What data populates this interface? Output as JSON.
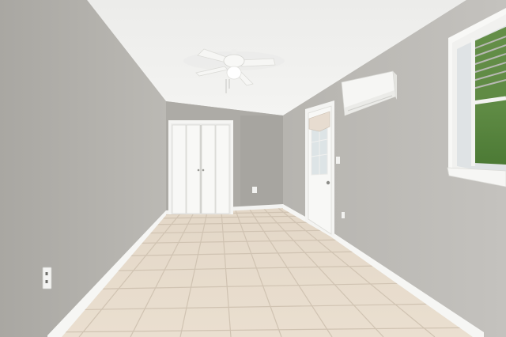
{
  "scene": {
    "subject": "empty-room-interior",
    "palette": {
      "ceiling": "#f1f1ef",
      "left_wall": "#b9b7b2",
      "back_wall": "#aeaca7",
      "right_wall": "#bebcb8",
      "floor_tile": "#e6d9c8",
      "grout": "#cfc2b1",
      "trim": "#f7f7f5",
      "foliage": "#5f8a43"
    },
    "fixtures": [
      "ceiling-fan",
      "closet-bifold-doors",
      "exterior-door-with-window",
      "mini-split-ac-unit",
      "double-hung-window",
      "electrical-outlet"
    ]
  }
}
